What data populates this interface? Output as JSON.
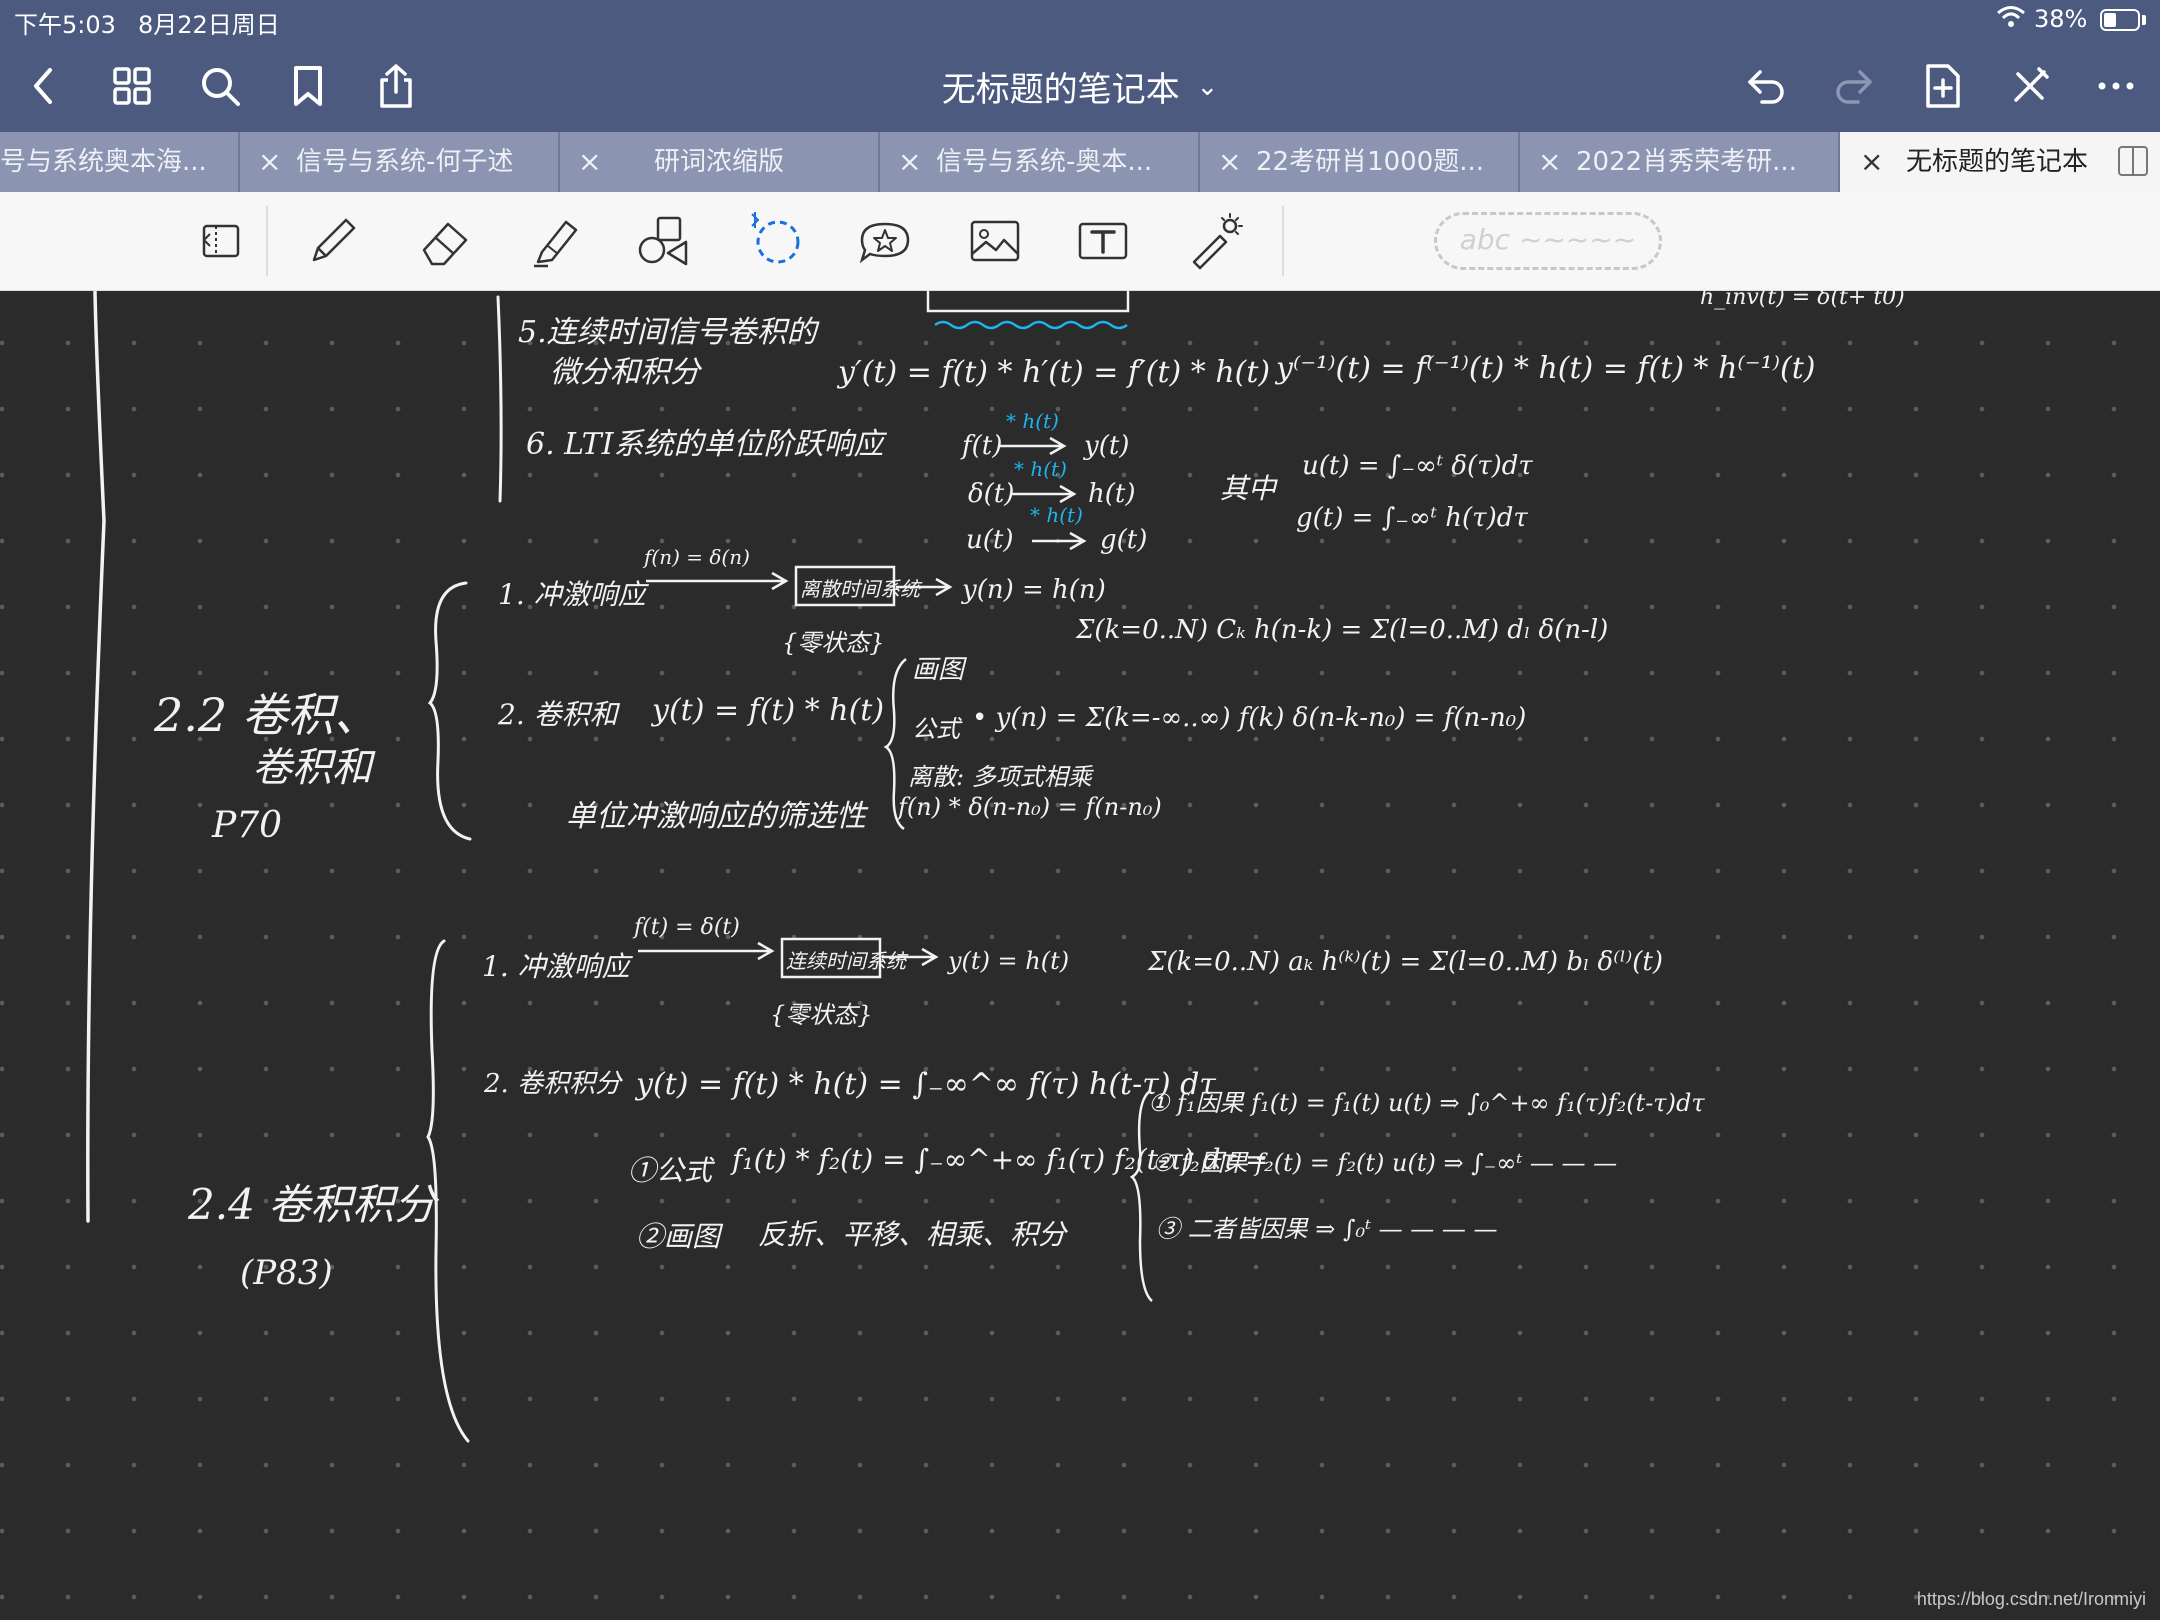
{
  "status_bar": {
    "time": "下午5:03",
    "date": "8月22日周日",
    "battery_percent": "38%",
    "battery_level": 0.38
  },
  "nav_bar": {
    "title": "无标题的笔记本",
    "title_chevron": "⌄",
    "left_icons": [
      "back-chevron-icon",
      "grid-icon",
      "search-icon",
      "bookmark-icon",
      "share-icon"
    ],
    "right_icons": [
      "undo-icon",
      "redo-icon",
      "add-page-icon",
      "close-pen-icon",
      "more-icon"
    ]
  },
  "tabs": [
    {
      "label": "号与系统奥本海...",
      "active": false
    },
    {
      "label": "信号与系统-何子述",
      "active": false
    },
    {
      "label": "研词浓缩版",
      "active": false
    },
    {
      "label": "信号与系统-奥本...",
      "active": false
    },
    {
      "label": "22考研肖1000题...",
      "active": false
    },
    {
      "label": "2022肖秀荣考研...",
      "active": false
    },
    {
      "label": "无标题的笔记本",
      "active": true
    }
  ],
  "tab_close_glyph": "×",
  "toolbar": {
    "tools": [
      "page-view-icon",
      "pen-icon",
      "eraser-icon",
      "highlighter-icon",
      "shapes-icon",
      "lasso-icon",
      "sticker-icon",
      "image-icon",
      "text-icon",
      "laser-pointer-icon"
    ],
    "pen_preset_placeholder": "abc ~~~~~",
    "accent_color": "#1a6fe0"
  },
  "notes": {
    "top_right_fragment": "h_inv(t) = δ(t+ t0)",
    "s5_title_1": "5.连续时间信号卷积的",
    "s5_title_2": "微分和积分",
    "s5_eq1": "y′(t) = f(t) * h′(t) = f′(t) * h(t)",
    "s5_eq2": "y⁽⁻¹⁾(t) = f⁽⁻¹⁾(t) * h(t) = f(t) * h⁽⁻¹⁾(t)",
    "s6_title": "6. LTI系统的单位阶跃响应",
    "s6_r1_a": "f(t)",
    "s6_r1_lbl": "* h(t)",
    "s6_r1_b": "y(t)",
    "s6_r2_a": "δ(t)",
    "s6_r2_lbl": "* h(t)",
    "s6_r2_b": "h(t)",
    "s6_r3_a": "u(t)",
    "s6_r3_lbl": "* h(t)",
    "s6_r3_b": "g(t)",
    "s6_where": "其中",
    "s6_u": "u(t) = ∫₋∞ᵗ δ(τ)dτ",
    "s6_g": "g(t) = ∫₋∞ᵗ h(τ)dτ",
    "s22_title_1": "2.2 卷积、",
    "s22_title_2": "卷积和",
    "s22_page": "P70",
    "s22_item1": "1. 冲激响应",
    "s22_fn": "f(n) = δ(n)",
    "s22_box": "离散时间系统",
    "s22_yn": "y(n) = h(n)",
    "s22_state": "{零状态}",
    "s22_diff": "Σ(k=0..N) Cₖ h(n-k) = Σ(l=0..M) dₗ δ(n-l)",
    "s22_item2": "2. 卷积和",
    "s22_conv": "y(t) = f(t) * h(t)",
    "s22_draw": "画图",
    "s22_formula_lbl": "公式",
    "s22_formula": "• y(n) = Σ(k=-∞..∞) f(k) δ(n-k-n₀) = f(n-n₀)",
    "s22_discrete": "离散: 多项式相乘",
    "s22_sift_title": "单位冲激响应的筛选性",
    "s22_sift": "f(n) * δ(n-n₀) = f(n-n₀)",
    "s24_title": "2.4 卷积积分",
    "s24_page": "(P83)",
    "s24_item1": "1. 冲激响应",
    "s24_ft": "f(t) = δ(t)",
    "s24_box": "连续时间系统",
    "s24_yt": "y(t) = h(t)",
    "s24_state": "{零状态}",
    "s24_diff": "Σ(k=0..N) aₖ h⁽ᵏ⁾(t) = Σ(l=0..M) bₗ δ⁽ˡ⁾(t)",
    "s24_item2": "2. 卷积积分",
    "s24_conv": "y(t) = f(t) * h(t) = ∫₋∞^∞ f(τ) h(t-τ) dτ",
    "s24_formula_lbl": "①公式",
    "s24_formula": "f₁(t) * f₂(t) = ∫₋∞^+∞ f₁(τ) f₂(t-τ) dτ =",
    "s24_draw_lbl": "②画图",
    "s24_draw": "反折、平移、相乘、积分",
    "s24_c1": "① f₁因果   f₁(t) = f₁(t) u(t)  ⇒ ∫₀^+∞ f₁(τ)f₂(t-τ)dτ",
    "s24_c2": "② f₂因果   f₂(t) = f₂(t) u(t)  ⇒ ∫₋∞ᵗ — — —",
    "s24_c3": "③ 二者皆因果              ⇒ ∫₀ᵗ — — — —"
  },
  "watermark": "https://blog.csdn.net/Ironmiyi"
}
